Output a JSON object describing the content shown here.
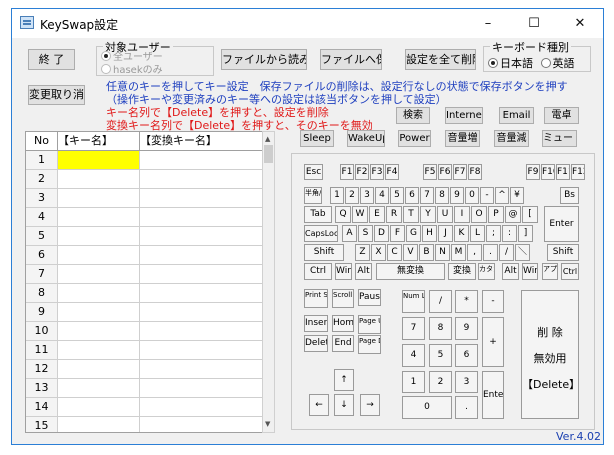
{
  "window": {
    "title": "KeySwap設定",
    "min": "–",
    "max": "☐",
    "close": "✕"
  },
  "top": {
    "exit": "終 了",
    "target_legend": "対象ユーザー",
    "target_all": "全ユーザー",
    "target_user": "hasekのみ",
    "load_file": "ファイルから読み込み",
    "save_file": "ファイルへ保存",
    "delete_all": "設定を全て削除",
    "kbtype_legend": "キーボード種別",
    "kb_jp": "日本語",
    "kb_en": "英語",
    "undo": "変更取り消し"
  },
  "messages": {
    "line1": "任意のキーを押してキー設定　保存ファイルの削除は、設定行なしの状態で保存ボタンを押す",
    "line2": "（操作キーや変更済みのキー等への設定は該当ボタンを押して設定）",
    "line3": "キー名列で【Delete】を押すと、設定を削除",
    "line4": "変換キー名列で【Delete】を押すと、そのキーを無効"
  },
  "table": {
    "headers": [
      "No",
      "【キー名】",
      "【変換キー名】"
    ],
    "rows": [
      "1",
      "2",
      "3",
      "4",
      "5",
      "6",
      "7",
      "8",
      "9",
      "10",
      "11",
      "12",
      "13",
      "14",
      "15"
    ]
  },
  "special_keys": {
    "row1": [
      "検索",
      "Internet",
      "Email",
      "電卓"
    ],
    "row2": [
      "Sleep",
      "WakeUp",
      "Power",
      "音量増",
      "音量減",
      "ミュート"
    ]
  },
  "keys": {
    "esc": "Esc",
    "f1_4": [
      "F1",
      "F2",
      "F3",
      "F4"
    ],
    "f5_8": [
      "F5",
      "F6",
      "F7",
      "F8"
    ],
    "f9_12": [
      "F9",
      "F10",
      "F11",
      "F12"
    ],
    "hankaku": "半角/全角",
    "num_row": [
      "1",
      "2",
      "3",
      "4",
      "5",
      "6",
      "7",
      "8",
      "9",
      "0",
      "-",
      "^",
      "¥"
    ],
    "bs": "Bs",
    "tab": "Tab",
    "q_row": [
      "Q",
      "W",
      "E",
      "R",
      "T",
      "Y",
      "U",
      "I",
      "O",
      "P",
      "@",
      "["
    ],
    "enter": "Enter",
    "caps": "CapsLock",
    "a_row": [
      "A",
      "S",
      "D",
      "F",
      "G",
      "H",
      "J",
      "K",
      "L",
      ";",
      ":",
      "]"
    ],
    "shift": "Shift",
    "z_row": [
      "Z",
      "X",
      "C",
      "V",
      "B",
      "N",
      "M",
      ",",
      ".",
      "/",
      "＼"
    ],
    "ctrl": "Ctrl",
    "win": "Win",
    "alt": "Alt",
    "muhenkan": "無変換",
    "henkan": "変換",
    "kana": "カタカナ",
    "apps": "アプリ",
    "print": "Print Scrn",
    "scroll": "Scroll Lock",
    "pause": "Pause",
    "insert": "Insert",
    "home": "Home",
    "pgup": "Page Up",
    "delete": "Delete",
    "end": "End",
    "pgdn": "Page Down",
    "up": "↑",
    "left": "←",
    "down": "↓",
    "right": "→",
    "numlock": "Num Lock",
    "div": "/",
    "mul": "*",
    "sub": "-",
    "n7": "7",
    "n8": "8",
    "n9": "9",
    "add": "+",
    "n4": "4",
    "n5": "5",
    "n6": "6",
    "n1": "1",
    "n2": "2",
    "n3": "3",
    "nenter": "Enter",
    "n0": "0",
    "ndot": "."
  },
  "disable": {
    "line1": "削 除",
    "line2": "無効用",
    "line3": "【Delete】"
  },
  "version": "Ver.4.02"
}
